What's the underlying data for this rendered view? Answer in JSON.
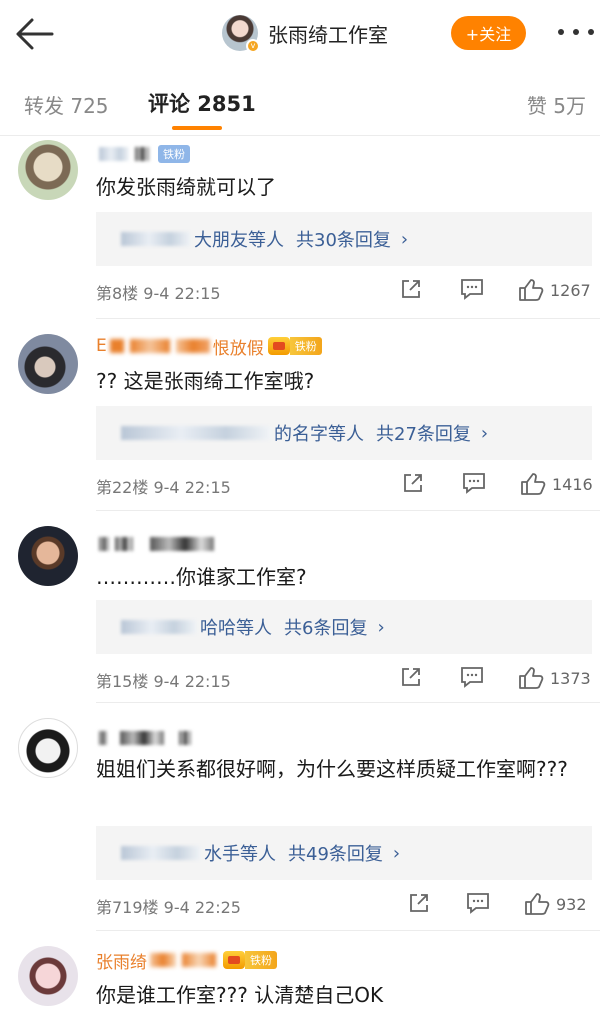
{
  "header": {
    "title": "张雨绮工作室",
    "follow_label": "+关注",
    "accent_color": "#ff8200"
  },
  "tabs": {
    "repost": "转发 725",
    "comment": "评论 2851",
    "like": "赞 5万"
  },
  "comments": [
    {
      "name_visible": "",
      "badge": "铁粉",
      "text": "你发张雨绮就可以了",
      "reply_who": "大朋友等人",
      "reply_count": "共30条回复",
      "floor": "第8楼",
      "time": "9-4 22:15",
      "likes": "1267"
    },
    {
      "name_prefix": "E",
      "name_suffix": "恨放假",
      "badge": "铁粉",
      "text": "?? 这是张雨绮工作室哦?",
      "reply_who": "的名字等人",
      "reply_count": "共27条回复",
      "floor": "第22楼",
      "time": "9-4 22:15",
      "likes": "1416"
    },
    {
      "text": "…………你谁家工作室?",
      "reply_who": "哈哈等人",
      "reply_count": "共6条回复",
      "floor": "第15楼",
      "time": "9-4 22:15",
      "likes": "1373"
    },
    {
      "text": "姐姐们关系都很好啊，为什么要这样质疑工作室啊???",
      "reply_who": "水手等人",
      "reply_count": "共49条回复",
      "floor": "第719楼",
      "time": "9-4 22:25",
      "likes": "932"
    },
    {
      "name_prefix": "张雨绮",
      "badge": "铁粉",
      "text": "你是谁工作室??? 认清楚自己OK"
    }
  ],
  "reply_arrow": "›"
}
